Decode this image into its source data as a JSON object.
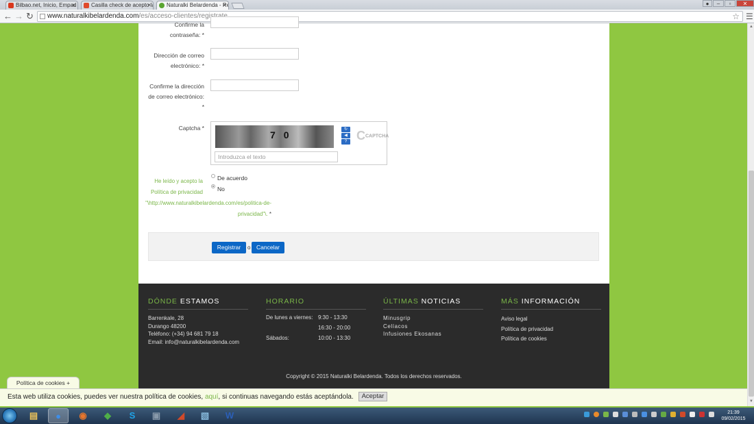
{
  "browser": {
    "tabs": [
      {
        "title": "Bilbao.net, Inicio, Empad",
        "favicon_color": "#d9381e",
        "active": false
      },
      {
        "title": "Casilla check de acepto la",
        "favicon_color": "#e04a2b",
        "active": false
      },
      {
        "title": "Naturalki Belardenda - Re",
        "favicon_color": "#5ba531",
        "active": true
      }
    ],
    "tab_close": "×",
    "url_domain": "www.naturalkibelardenda.com",
    "url_path": "/es/acceso-clientes/registrate",
    "window_minimize": "‒",
    "window_maximize": "▫",
    "window_close": "✕"
  },
  "form": {
    "confirm_password_label": "Confirme la contraseña: *",
    "email_label": "Dirección de correo electrónico: *",
    "confirm_email_label": "Confirme la dirección de correo electrónico: *",
    "captcha_label": "Captcha *",
    "captcha_text": "70",
    "captcha_logo": "CAPTCHA",
    "captcha_placeholder": "Introduzca el texto",
    "privacy_label": "He leído y acepto la Política de privacidad",
    "privacy_url": "\"\\http://www.naturalkibelardenda.com/es/politica-de-privacidad\"\\.",
    "privacy_required": "*",
    "radio_agree": "De acuerdo",
    "radio_no": "No",
    "register_button": "Registrar",
    "or_text": "o",
    "cancel_button": "Cancelar"
  },
  "footer": {
    "where": {
      "heading_accent": "DÓNDE",
      "heading_rest": "ESTAMOS",
      "lines": [
        "Barrenkale, 28",
        "Durango 48200",
        "Teléfono: (+34) 94 681 79 18",
        "Email: info@naturalkibelardenda.com"
      ]
    },
    "schedule": {
      "heading": "HORARIO",
      "weekdays_label": "De lunes a viernes:",
      "weekdays_morning": "9:30 - 13:30",
      "weekdays_afternoon": "16:30 - 20:00",
      "saturday_label": "Sábados:",
      "saturday_hours": "10:00 - 13:30"
    },
    "news": {
      "heading_accent": "ÚLTIMAS",
      "heading_rest": "NOTICIAS",
      "items": [
        "Minusgrip",
        "Celíacos",
        "Infusiones Ekosanas"
      ]
    },
    "info": {
      "heading_accent": "MÁS",
      "heading_rest": "INFORMACIÓN",
      "items": [
        "Aviso legal",
        "Política de privacidad",
        "Política de cookies"
      ]
    },
    "copyright": "Copyright © 2015 Naturalki Belardenda. Todos los derechos reservados."
  },
  "cookies": {
    "tab_label": "Política de cookies +",
    "message_before": "Esta web utiliza cookies, puedes ver nuestra política de cookies,",
    "link_text": "aquí",
    "message_after": ", si continuas navegando estás aceptándola.",
    "accept_button": "Aceptar"
  },
  "taskbar": {
    "apps": [
      {
        "name": "explorer",
        "color": "#e8c15a",
        "glyph": "▤",
        "active": false
      },
      {
        "name": "chrome",
        "color": "#3d8ee8",
        "glyph": "●",
        "active": true
      },
      {
        "name": "firefox",
        "color": "#e8762b",
        "glyph": "◉",
        "active": false
      },
      {
        "name": "network",
        "color": "#4fae48",
        "glyph": "◆",
        "active": false
      },
      {
        "name": "skype",
        "color": "#1fa3e8",
        "glyph": "S",
        "active": false
      },
      {
        "name": "window",
        "color": "#8899aa",
        "glyph": "▣",
        "active": false
      },
      {
        "name": "filezilla",
        "color": "#d04a2a",
        "glyph": "◢",
        "active": false
      },
      {
        "name": "paint",
        "color": "#88bbdd",
        "glyph": "▧",
        "active": false
      },
      {
        "name": "word",
        "color": "#2b5fb8",
        "glyph": "W",
        "active": false
      }
    ],
    "time": "21:39",
    "date": "09/02/2015"
  }
}
